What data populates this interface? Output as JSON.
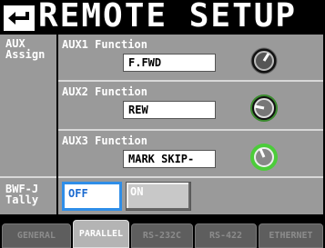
{
  "header": {
    "title": "REMOTE SETUP"
  },
  "aux_assign": {
    "section_label": "AUX\nAssign",
    "rows": [
      {
        "label": "AUX1 Function",
        "value": "F.FWD"
      },
      {
        "label": "AUX2 Function",
        "value": "REW"
      },
      {
        "label": "AUX3 Function",
        "value": "MARK SKIP-"
      }
    ]
  },
  "bwf_j_tally": {
    "section_label": "BWF-J\nTally",
    "options": [
      {
        "label": "OFF",
        "selected": true
      },
      {
        "label": "ON",
        "selected": false
      }
    ]
  },
  "tabs": [
    {
      "label": "GENERAL",
      "active": false
    },
    {
      "label": "PARALLEL",
      "active": true
    },
    {
      "label": "RS-232C",
      "active": false
    },
    {
      "label": "RS-422",
      "active": false
    },
    {
      "label": "ETHERNET",
      "active": false
    }
  ],
  "colors": {
    "panel": "#9a9a9a",
    "selected_border": "#2f8ee8",
    "knob_active": "#4ccc3a",
    "knob_inactive": "#444444"
  }
}
